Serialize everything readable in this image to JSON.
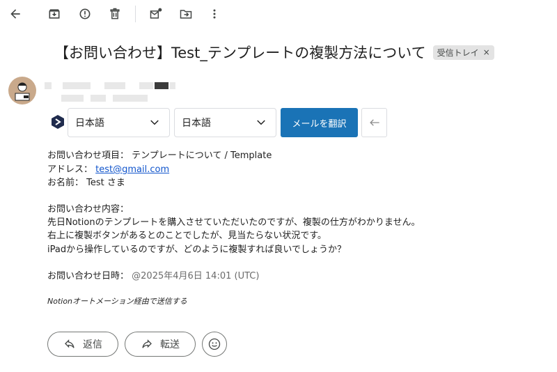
{
  "toolbar": {
    "icons": [
      "back-arrow-icon",
      "archive-icon",
      "report-spam-icon",
      "delete-icon",
      "mark-unread-icon",
      "move-to-icon",
      "more-options-icon"
    ]
  },
  "email": {
    "subject": "【お問い合わせ】Test_テンプレートの複製方法について",
    "label": "受信トレイ",
    "label_remove": "×"
  },
  "translate": {
    "source_lang": "日本語",
    "target_lang": "日本語",
    "translate_button": "メールを翻訳"
  },
  "body": {
    "item_label": "お問い合わせ項目：",
    "item_value": "テンプレートについて / Template",
    "address_label": "アドレス：",
    "address_value": "test@gmail.com",
    "name_label": "お名前：",
    "name_value": "Test さま",
    "content_label": "お問い合わせ内容：",
    "content_line1": "先日Notionのテンプレートを購入させていただいたのですが、複製の仕方がわかりません。",
    "content_line2": "右上に複製ボタンがあるとのことでしたが、見当たらない状況です。",
    "content_line3": "iPadから操作しているのですが、どのように複製すれば良いでしょうか？",
    "date_label": "お問い合わせ日時：",
    "date_value": "@2025年4月6日 14:01 (UTC)",
    "footer_note": "Notionオートメーション経由で送信する"
  },
  "actions": {
    "reply_label": "返信",
    "forward_label": "転送"
  },
  "colors": {
    "translate_button_bg": "#1a73b6",
    "link": "#1155cc"
  }
}
